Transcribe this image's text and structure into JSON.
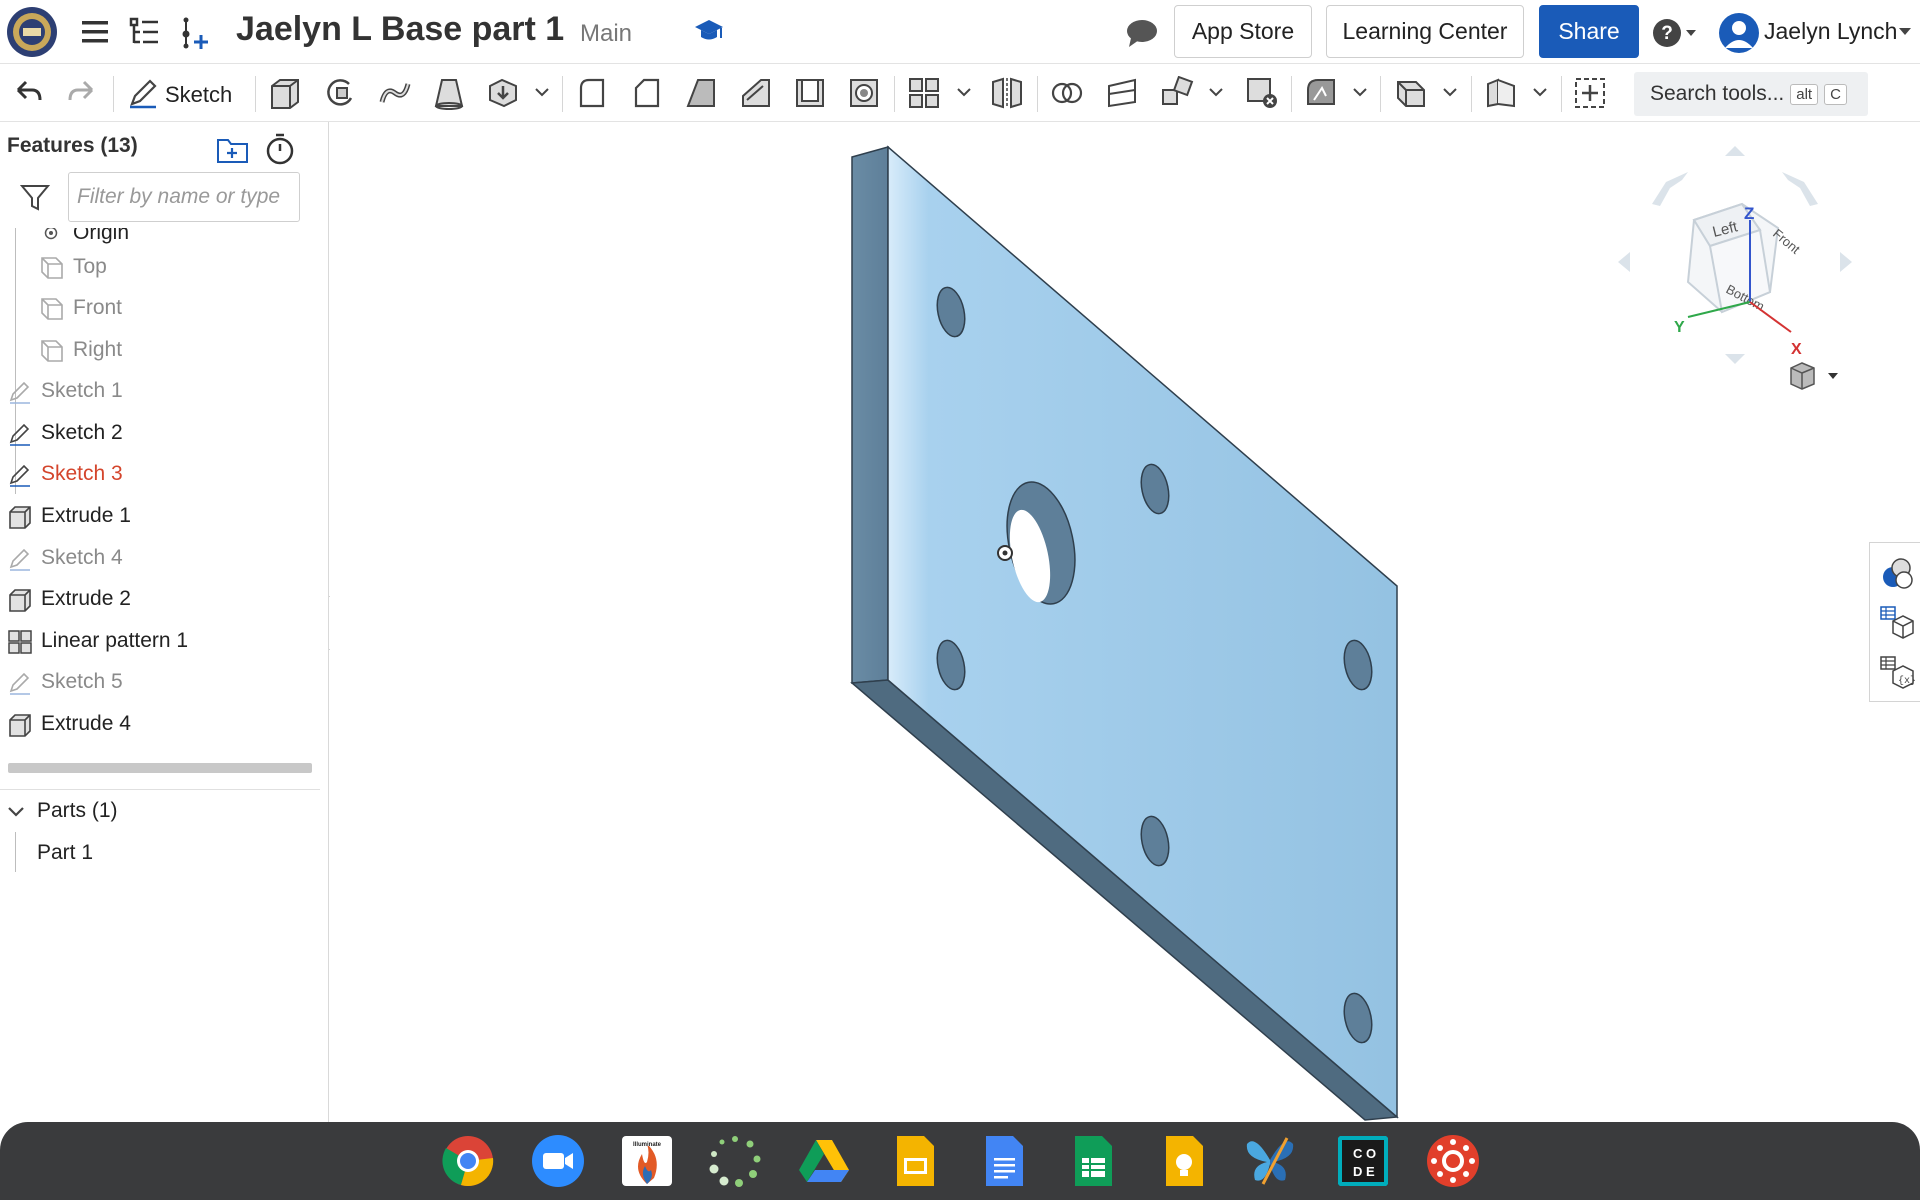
{
  "header": {
    "doc_title": "Jaelyn L Base part 1",
    "branch": "Main",
    "app_store": "App Store",
    "learning_center": "Learning Center",
    "share": "Share",
    "user_name": "Jaelyn Lynch"
  },
  "toolbar": {
    "sketch_label": "Sketch",
    "search_label": "Search tools...",
    "search_key1": "alt",
    "search_key2": "C"
  },
  "panel": {
    "features_title": "Features (13)",
    "filter_placeholder": "Filter by name or type",
    "items": [
      {
        "label": "Origin"
      },
      {
        "label": "Top"
      },
      {
        "label": "Front"
      },
      {
        "label": "Right"
      },
      {
        "label": "Sketch 1"
      },
      {
        "label": "Sketch 2"
      },
      {
        "label": "Sketch 3"
      },
      {
        "label": "Extrude 1"
      },
      {
        "label": "Sketch 4"
      },
      {
        "label": "Extrude 2"
      },
      {
        "label": "Linear pattern 1"
      },
      {
        "label": "Sketch 5"
      },
      {
        "label": "Extrude 4"
      }
    ],
    "parts_title": "Parts (1)",
    "parts": [
      {
        "label": "Part 1"
      }
    ]
  },
  "viewcube": {
    "faces": [
      "Left",
      "Front",
      "Bottom"
    ],
    "axes": [
      "Z",
      "Y",
      "X"
    ]
  },
  "colors": {
    "accent": "#1a5bb8",
    "part_face": "#9cc7e6",
    "part_edge": "#5e7f99",
    "active_sketch": "#d4452c"
  },
  "dock_apps": [
    "chrome-icon",
    "zoom-icon",
    "illuminate-icon",
    "dots-icon",
    "drive-icon",
    "slides-icon",
    "docs-icon",
    "sheets-icon",
    "keep-icon",
    "butterfly-icon",
    "code-icon",
    "canvas-icon"
  ]
}
